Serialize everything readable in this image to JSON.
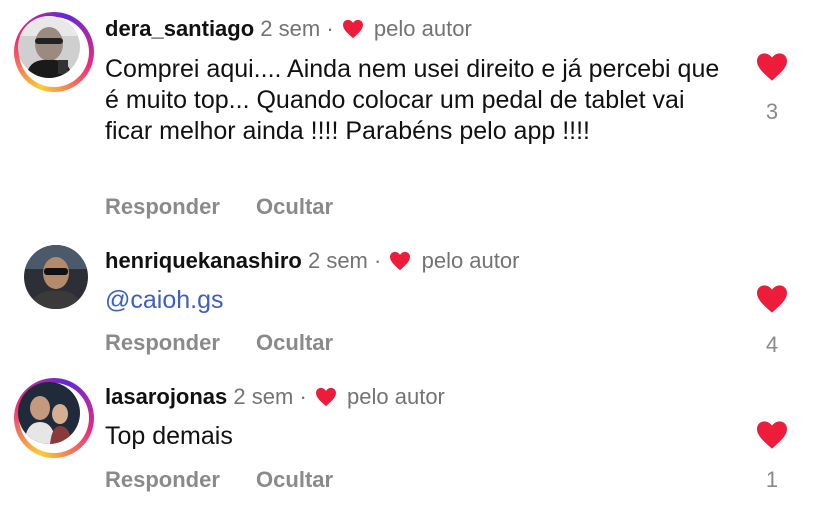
{
  "comments": [
    {
      "username": "dera_santiago",
      "time": "2 sem",
      "separator": "·",
      "liked_by_author": "pelo autor",
      "text": "Comprei aqui.... Ainda nem usei direito e já percebi que é muito top... Quando colocar um pedal de tablet vai ficar melhor ainda !!!! Parabéns pelo app !!!!",
      "reply_label": "Responder",
      "hide_label": "Ocultar",
      "like_count": "3"
    },
    {
      "username": "henriquekanashiro",
      "time": "2 sem",
      "separator": "·",
      "liked_by_author": "pelo autor",
      "text": "@caioh.gs",
      "reply_label": "Responder",
      "hide_label": "Ocultar",
      "like_count": "4"
    },
    {
      "username": "lasarojonas",
      "time": "2 sem",
      "separator": "·",
      "liked_by_author": "pelo autor",
      "text": "Top demais",
      "reply_label": "Responder",
      "hide_label": "Ocultar",
      "like_count": "1"
    }
  ],
  "colors": {
    "heart": "#ed1c3a",
    "mention": "#3b5fc4",
    "muted": "#8a8a8a"
  },
  "icons": {
    "author_like": "heart-icon",
    "like_button": "heart-filled-icon"
  }
}
